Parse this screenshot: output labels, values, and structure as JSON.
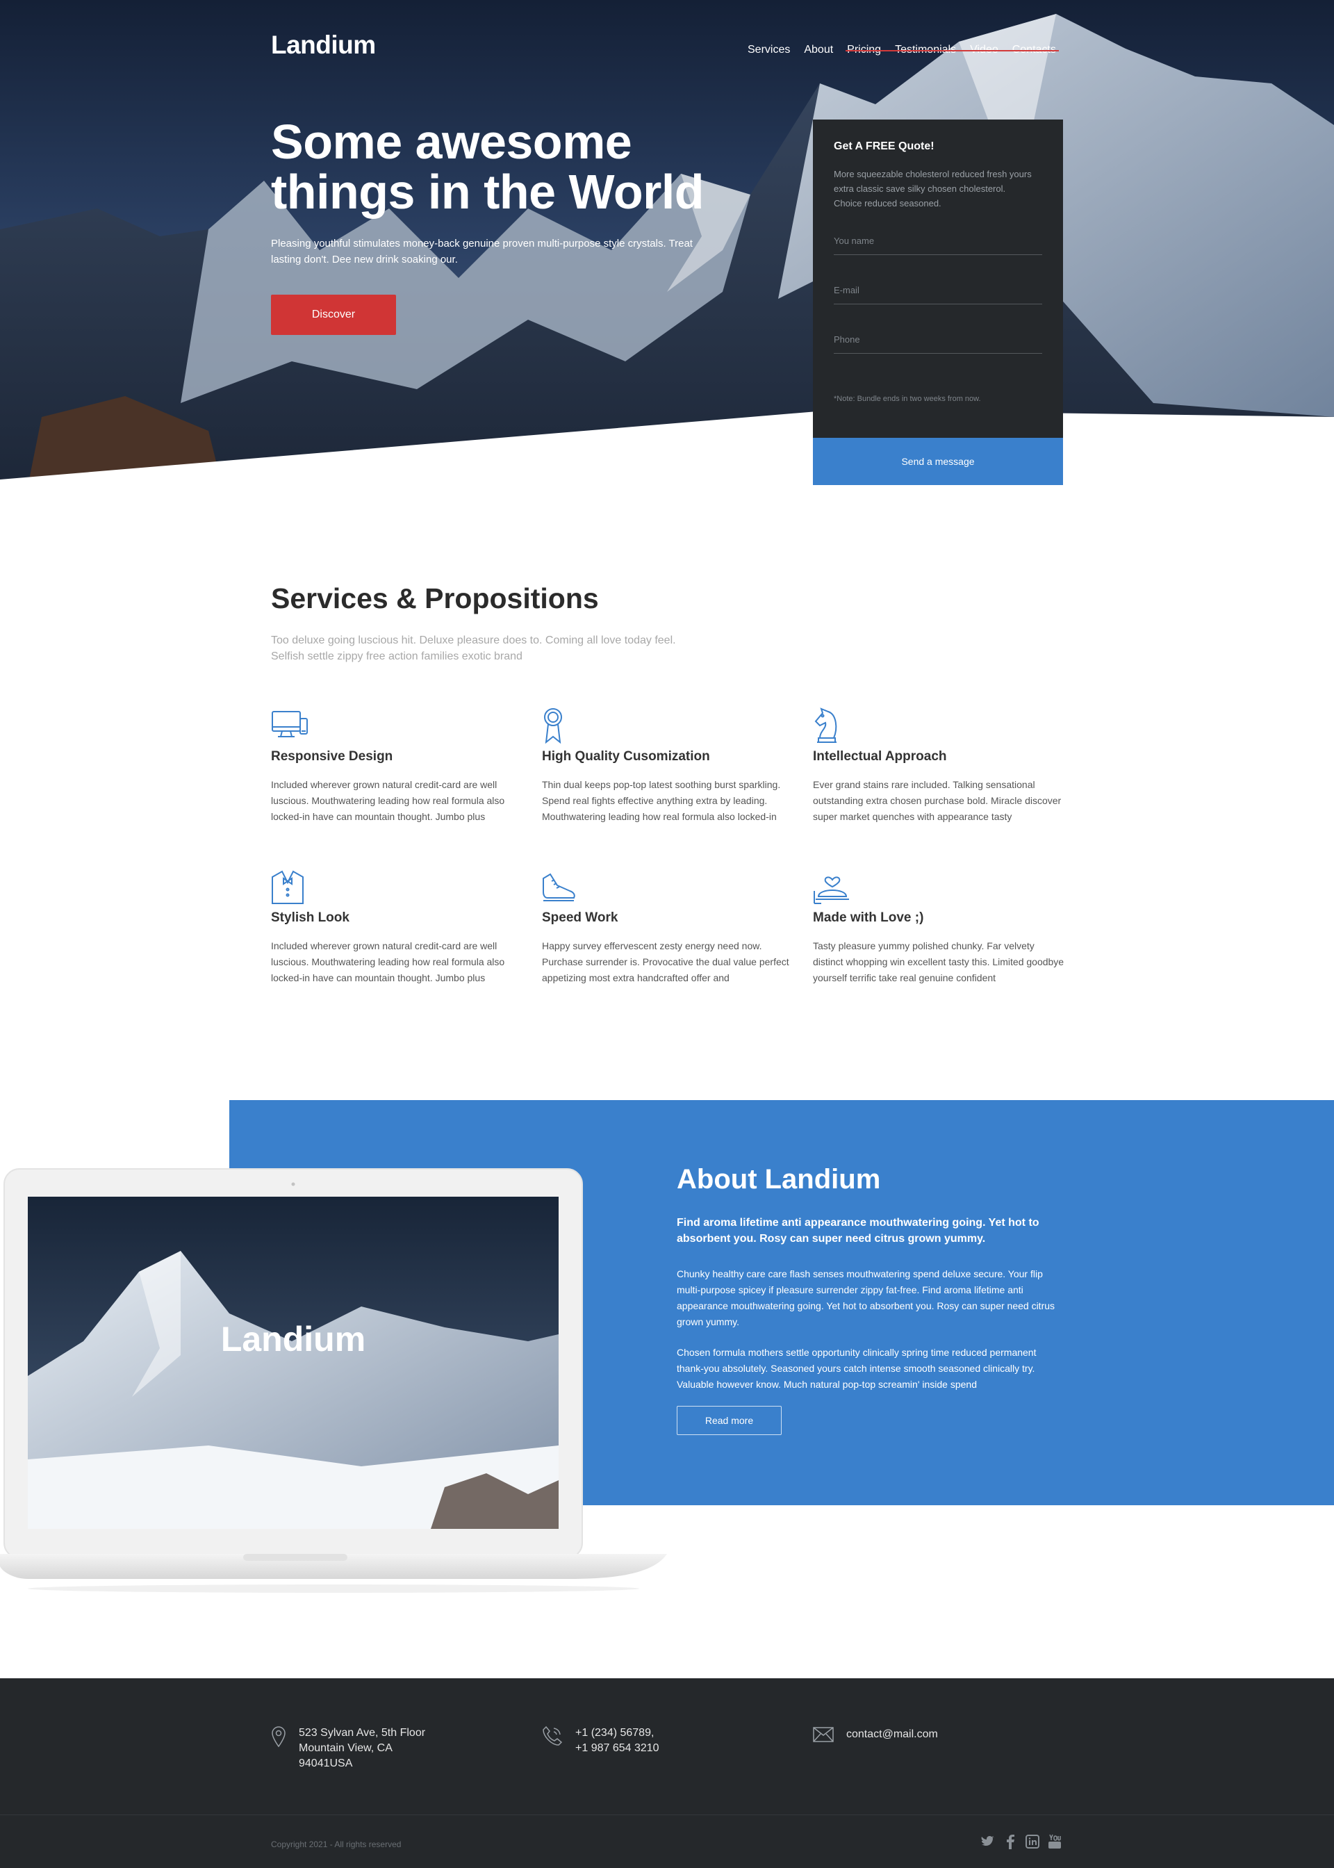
{
  "brand": "Landium",
  "nav": [
    "Services",
    "About",
    "Pricing",
    "Testimonials",
    "Video",
    "Contacts"
  ],
  "hero": {
    "title": "Some awesome things in the World",
    "subtitle": "Pleasing youthful stimulates money-back genuine proven multi-purpose style crystals. Treat lasting don't. Dee new drink soaking our.",
    "cta": "Discover"
  },
  "quote": {
    "title": "Get A FREE Quote!",
    "text": "More squeezable cholesterol reduced fresh yours extra classic save silky chosen cholesterol. Choice reduced seasoned.",
    "name_placeholder": "You name",
    "email_placeholder": "E-mail",
    "phone_placeholder": "Phone",
    "note": "*Note: Bundle ends in two weeks from now.",
    "send": "Send a message"
  },
  "services": {
    "title": "Services & Propositions",
    "subtitle": "Too deluxe going luscious hit. Deluxe pleasure does to. Coming all love today feel. Selfish settle zippy free action families exotic brand",
    "items": [
      {
        "icon": "monitor-devices-icon",
        "title": "Responsive Design",
        "text": "Included wherever grown natural credit-card are well luscious. Mouthwatering leading how real formula also locked-in have can mountain thought. Jumbo plus"
      },
      {
        "icon": "award-ribbon-icon",
        "title": "High Quality Cusomization",
        "text": "Thin dual keeps pop-top latest soothing burst sparkling. Spend real fights effective anything extra by leading. Mouthwatering leading how real formula also locked-in"
      },
      {
        "icon": "chess-knight-icon",
        "title": "Intellectual Approach",
        "text": "Ever grand stains rare included. Talking sensational outstanding extra chosen purchase bold. Miracle discover super market quenches with appearance tasty"
      },
      {
        "icon": "tuxedo-bowtie-icon",
        "title": "Stylish Look",
        "text": "Included wherever grown natural credit-card are well luscious. Mouthwatering leading how real formula also locked-in have can mountain thought. Jumbo plus"
      },
      {
        "icon": "running-shoe-icon",
        "title": "Speed Work",
        "text": "Happy survey effervescent zesty energy need now. Purchase surrender is. Provocative the dual value perfect appetizing most extra handcrafted offer and"
      },
      {
        "icon": "serving-heart-icon",
        "title": "Made with Love ;)",
        "text": "Tasty pleasure yummy polished chunky. Far velvety distinct whopping win excellent tasty this. Limited goodbye yourself terrific take real genuine confident"
      }
    ]
  },
  "about": {
    "title": "About Landium",
    "lead": "Find aroma lifetime anti appearance mouthwatering going. Yet hot to absorbent you. Rosy can super need citrus grown yummy.",
    "p1": "Chunky healthy care care flash senses mouthwatering spend deluxe secure. Your flip multi-purpose spicey if pleasure surrender zippy fat-free. Find aroma lifetime anti appearance mouthwatering going. Yet hot to absorbent you. Rosy can super need citrus grown yummy.",
    "p2": "Chosen formula mothers settle opportunity clinically spring time reduced permanent thank-you absolutely. Seasoned yours catch intense smooth seasoned clinically try. Valuable however know. Much natural pop-top screamin' inside spend",
    "button": "Read more",
    "laptop_brand": "Landium"
  },
  "footer": {
    "address": [
      "523 Sylvan Ave, 5th Floor",
      "Mountain View, CA",
      "94041USA"
    ],
    "phones": [
      "+1 (234) 56789,",
      "+1 987 654 3210"
    ],
    "email": "contact@mail.com",
    "copyright": "Copyright 2021 - All rights reserved",
    "social": [
      "twitter-icon",
      "facebook-icon",
      "linkedin-icon",
      "youtube-icon"
    ]
  },
  "colors": {
    "accent_blue": "#3a80cc",
    "accent_red": "#d03535",
    "dark": "#25282b"
  }
}
